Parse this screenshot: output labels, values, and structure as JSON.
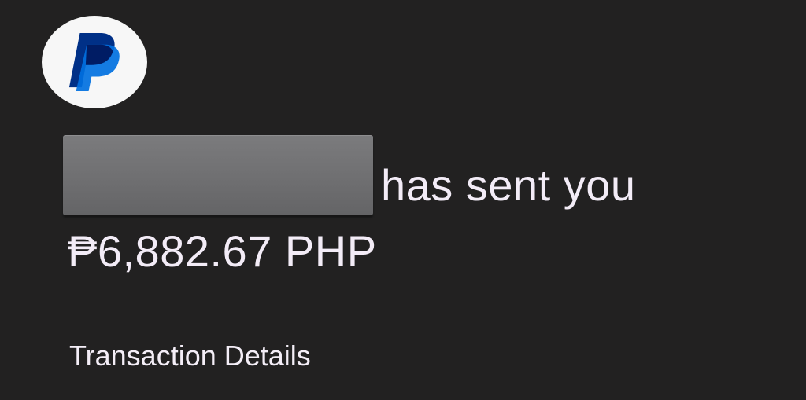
{
  "notification": {
    "logo_icon": "paypal-logo-icon",
    "brand_colors": {
      "dark_blue": "#003087",
      "light_blue": "#0070e0",
      "logo_background": "#f7f7f7"
    },
    "sender_redacted": true,
    "headline": "has sent you",
    "amount": "₱6,882.67 PHP",
    "section_title": "Transaction Details"
  },
  "theme": {
    "background": "#222121",
    "text": "#f3ecf7"
  }
}
